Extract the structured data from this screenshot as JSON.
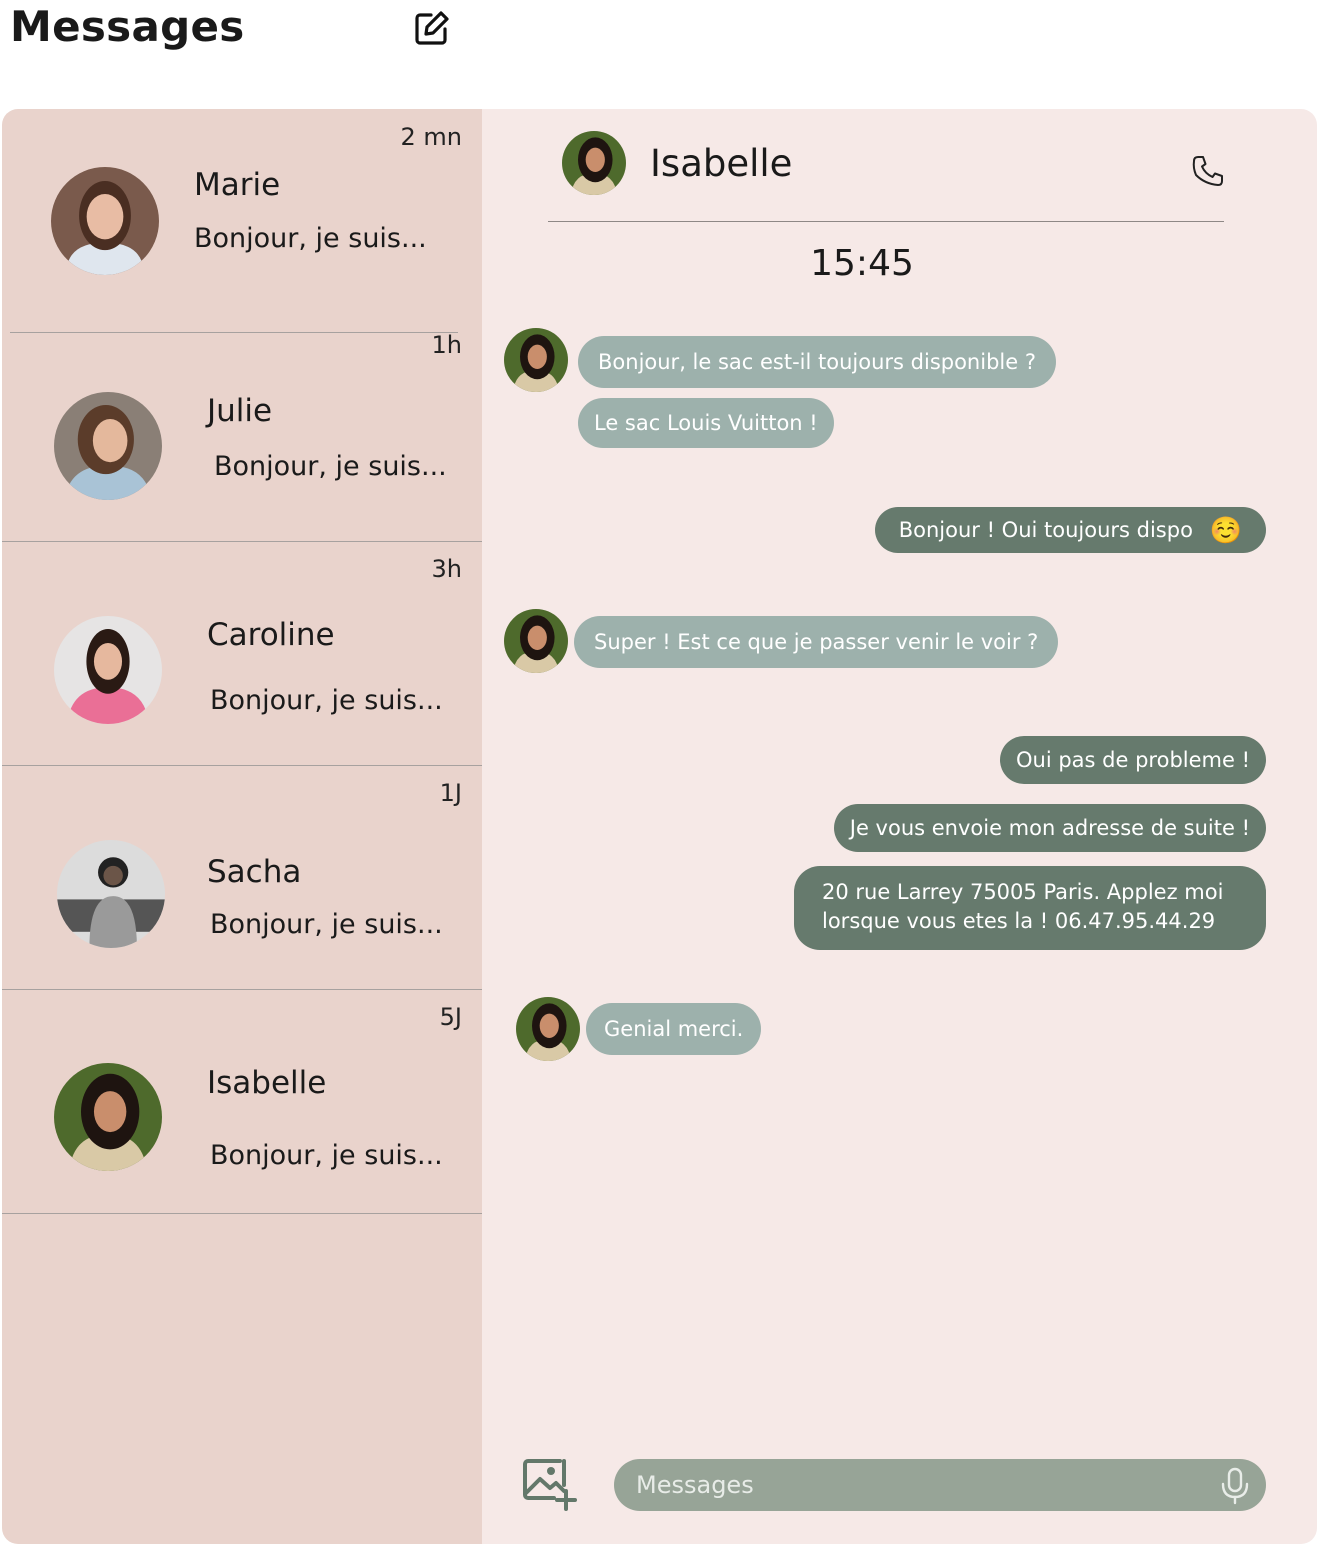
{
  "app": {
    "title": "Messages"
  },
  "conversations": [
    {
      "name": "Marie",
      "preview": "Bonjour, je suis...",
      "time": "2 mn"
    },
    {
      "name": "Julie",
      "preview": "Bonjour, je suis...",
      "time": "1h"
    },
    {
      "name": "Caroline",
      "preview": "Bonjour, je suis...",
      "time": "3h"
    },
    {
      "name": "Sacha",
      "preview": "Bonjour, je suis...",
      "time": "1J"
    },
    {
      "name": "Isabelle",
      "preview": "Bonjour, je suis...",
      "time": "5J"
    }
  ],
  "chat": {
    "contact_name": "Isabelle",
    "time": "15:45",
    "messages": [
      {
        "direction": "in",
        "text": "Bonjour, le sac est-il toujours disponible ?"
      },
      {
        "direction": "in",
        "text": "Le sac Louis Vuitton !"
      },
      {
        "direction": "out",
        "text": "Bonjour ! Oui toujours dispo",
        "emoji": "☺️"
      },
      {
        "direction": "in",
        "text": "Super ! Est ce que je passer venir le voir ?"
      },
      {
        "direction": "out",
        "text": "Oui pas de probleme !"
      },
      {
        "direction": "out",
        "text": "Je vous envoie mon adresse de suite !"
      },
      {
        "direction": "out",
        "text": "20 rue Larrey 75005 Paris. Applez moi lorsque vous etes la ! 06.47.95.44.29"
      },
      {
        "direction": "in",
        "text": "Genial merci."
      }
    ],
    "input": {
      "placeholder": "Messages",
      "value": ""
    }
  },
  "icons": {
    "compose": "compose-icon",
    "call": "phone-icon",
    "image_add": "image-add-icon",
    "mic": "microphone-icon"
  },
  "colors": {
    "sidebar_bg": "#e9d3cc",
    "chat_bg": "#f6e9e7",
    "incoming_bubble": "#9db1ac",
    "outgoing_bubble": "#667a6d",
    "input_bg": "#97a497"
  }
}
